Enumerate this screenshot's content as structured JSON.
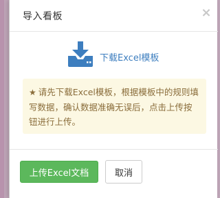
{
  "modal": {
    "title": "导入看板",
    "close_glyph": "×"
  },
  "download": {
    "icon": "download-icon",
    "label": "下载Excel模板",
    "color": "#3d7ebf"
  },
  "alert": {
    "icon": "star-icon",
    "icon_glyph": "★",
    "text": "请先下载Excel模板，根据模板中的规则填写数据，确认数据准确无误后，点击上传按钮进行上传。",
    "background": "#fcf8e3",
    "color": "#8a6d3b"
  },
  "footer": {
    "upload_label": "上传Excel文档",
    "upload_color": "#5cb85c",
    "cancel_label": "取消"
  }
}
